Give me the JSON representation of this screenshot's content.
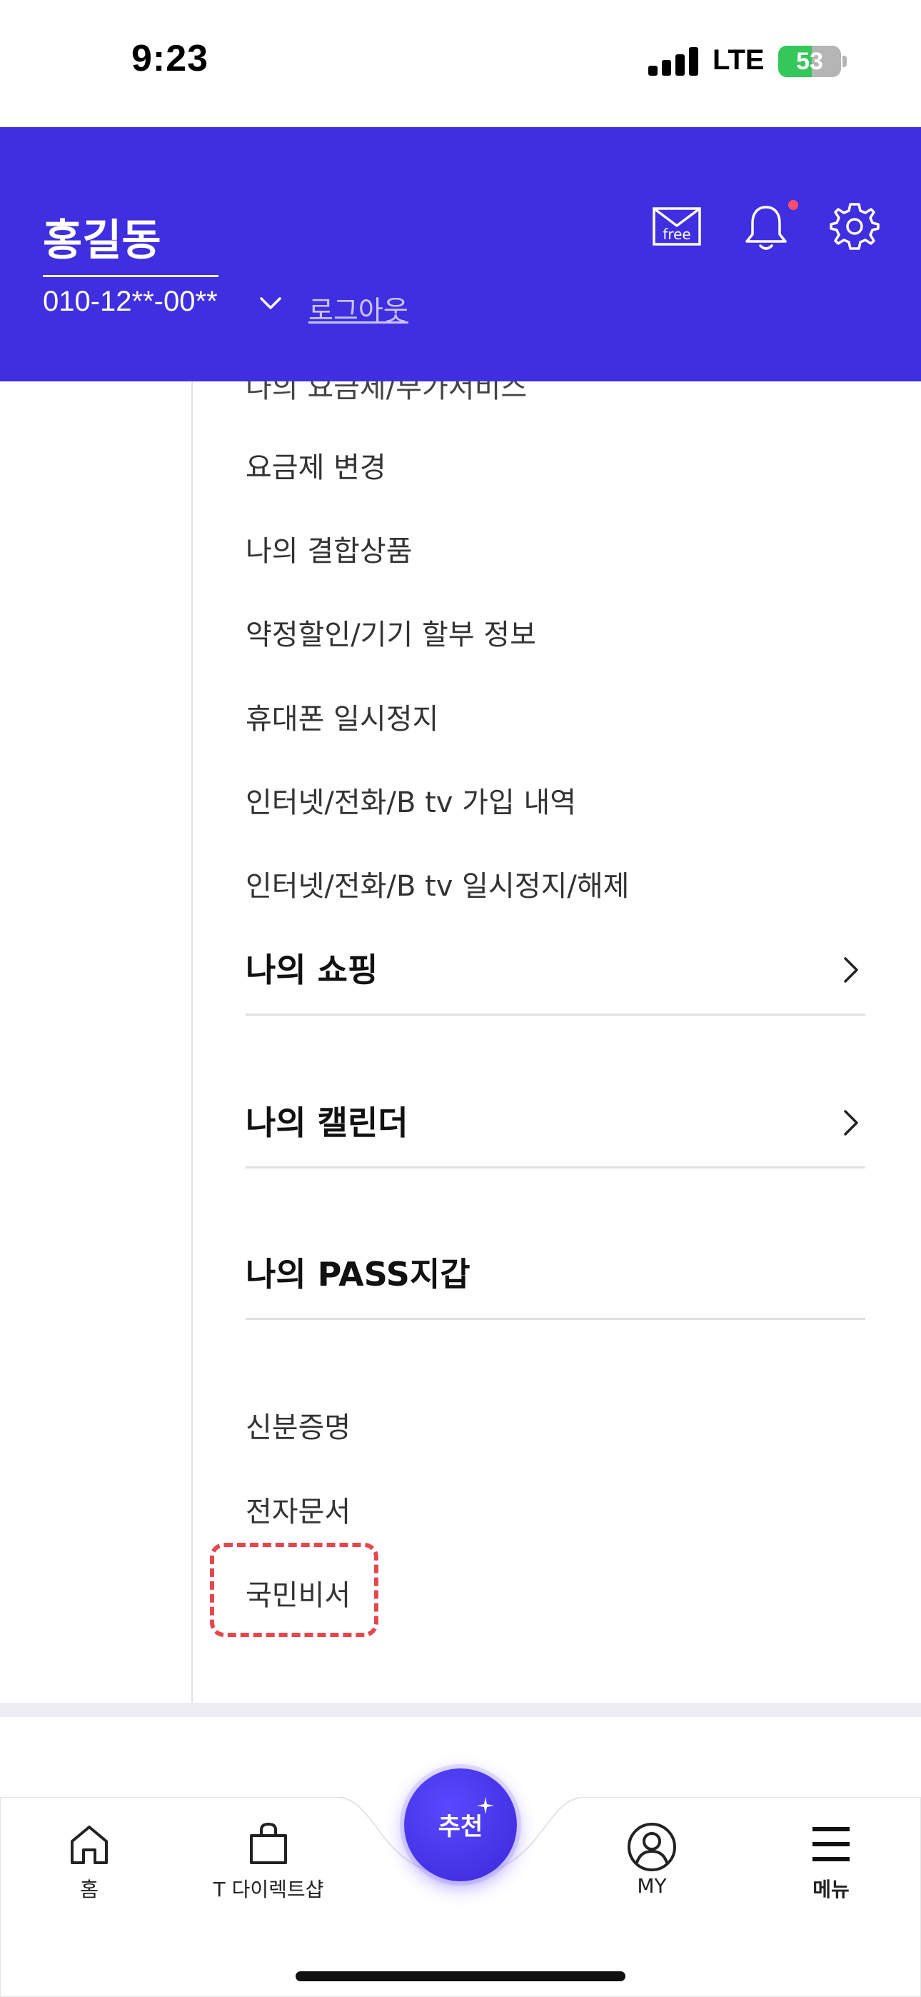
{
  "status_bar": {
    "time": "9:23",
    "network": "LTE",
    "battery": "53",
    "battery_level": 0.53
  },
  "header": {
    "user_name": "홍길동",
    "phone_number": "010-12**-00**",
    "logout_label": "로그아웃",
    "icons": [
      "mail-free-icon",
      "bell-icon",
      "gear-icon"
    ],
    "mail_badge_text": "free",
    "accent_color": "#3f2fe0"
  },
  "menu": {
    "partial_item": "나의 요금제/부가서비스",
    "plan_items": [
      "요금제 변경",
      "나의 결합상품",
      "약정할인/기기 할부 정보",
      "휴대폰 일시정지",
      "인터넷/전화/B tv 가입 내역",
      "인터넷/전화/B tv 일시정지/해제"
    ],
    "sections": [
      {
        "title": "나의 쇼핑",
        "has_chevron": true
      },
      {
        "title": "나의 캘린더",
        "has_chevron": true
      },
      {
        "title": "나의 PASS지갑",
        "has_chevron": false
      }
    ],
    "pass_items": [
      "신분증명",
      "전자문서",
      "국민비서"
    ],
    "highlighted_item": "국민비서"
  },
  "tab_bar": {
    "items": [
      {
        "label": "홈",
        "icon": "home-icon"
      },
      {
        "label": "T 다이렉트샵",
        "icon": "shopping-bag-icon"
      },
      {
        "label": "MY",
        "icon": "profile-icon"
      },
      {
        "label": "메뉴",
        "icon": "hamburger-menu-icon"
      }
    ],
    "center_button": "추천"
  }
}
